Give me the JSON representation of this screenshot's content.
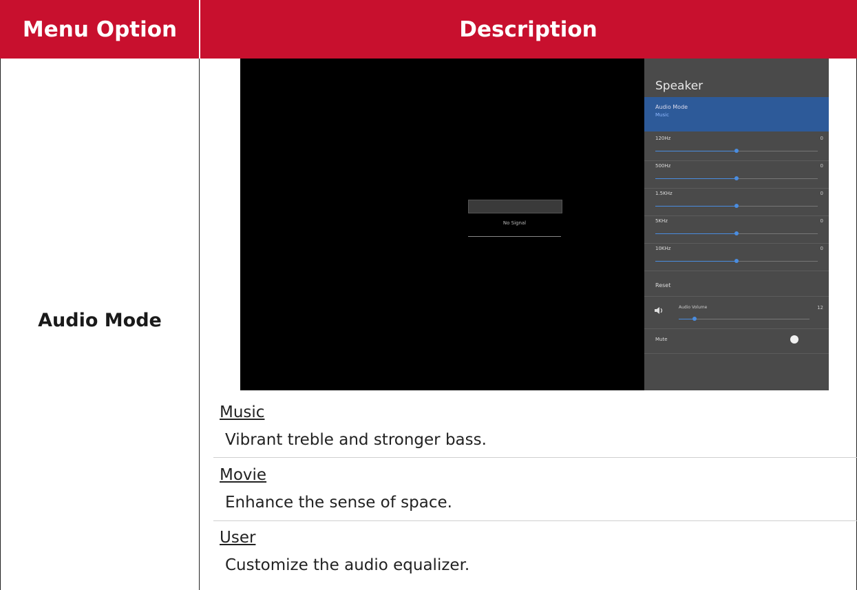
{
  "header": {
    "col1": "Menu Option",
    "col2": "Description"
  },
  "row": {
    "option": "Audio Mode"
  },
  "screenshot": {
    "popup_text": "No Signal",
    "panel_title": "Speaker",
    "audio_mode_label": "Audio Mode",
    "audio_mode_value": "Music",
    "bands": [
      {
        "label": "120Hz",
        "value": "0",
        "level": 0.5
      },
      {
        "label": "500Hz",
        "value": "0",
        "level": 0.5
      },
      {
        "label": "1.5KHz",
        "value": "0",
        "level": 0.5
      },
      {
        "label": "5KHz",
        "value": "0",
        "level": 0.5
      },
      {
        "label": "10KHz",
        "value": "0",
        "level": 0.5
      }
    ],
    "reset_label": "Reset",
    "volume_label": "Audio Volume",
    "volume_value": "12",
    "volume_level": 0.12,
    "mute_label": "Mute",
    "colors": {
      "panel_bg": "#4a4a4a",
      "highlight": "#2d5a99",
      "slider": "#4a8de0"
    }
  },
  "modes": [
    {
      "title": "Music",
      "desc": "Vibrant treble and stronger bass."
    },
    {
      "title": "Movie",
      "desc": "Enhance the sense of space."
    },
    {
      "title": "User",
      "desc": "Customize the audio equalizer."
    }
  ],
  "colors": {
    "header_bg": "#c8102e"
  }
}
